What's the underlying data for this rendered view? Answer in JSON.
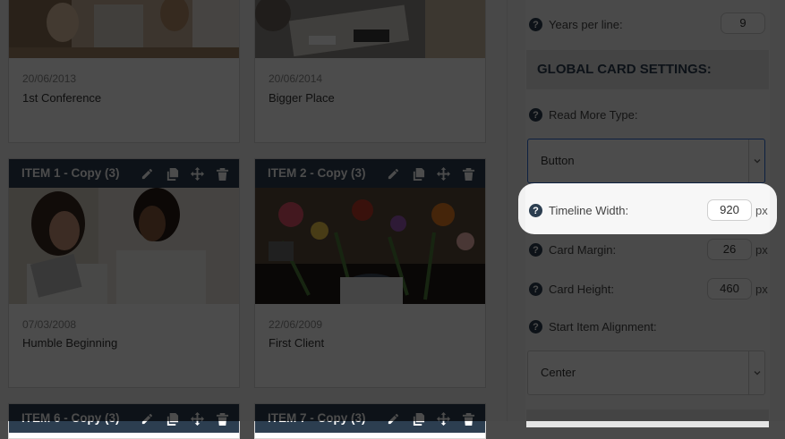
{
  "cards_top": [
    {
      "date": "20/06/2013",
      "title": "1st Conference"
    },
    {
      "date": "20/06/2014",
      "title": "Bigger Place"
    }
  ],
  "cards_mid": [
    {
      "header": "ITEM 1 - Copy (3)",
      "date": "07/03/2008",
      "title": "Humble Beginning"
    },
    {
      "header": "ITEM 2 - Copy (3)",
      "date": "22/06/2009",
      "title": "First Client"
    }
  ],
  "cards_bottom": [
    {
      "header": "ITEM 6 - Copy (3)"
    },
    {
      "header": "ITEM 7 - Copy (3)"
    }
  ],
  "settings": {
    "years_per_line_label": "Years per line:",
    "years_per_line_value": "9",
    "global_heading": "GLOBAL CARD SETTINGS:",
    "read_more_label": "Read More Type:",
    "read_more_value": "Button",
    "timeline_width_label": "Timeline Width:",
    "timeline_width_value": "920",
    "card_margin_label": "Card Margin:",
    "card_margin_value": "26",
    "card_height_label": "Card Height:",
    "card_height_value": "460",
    "start_align_label": "Start Item Alignment:",
    "start_align_value": "Center",
    "unit": "px",
    "help_glyph": "?"
  },
  "icons": [
    "pencil-icon",
    "copy-icon",
    "move-icon",
    "trash-icon",
    "help-icon",
    "chevron-down-icon"
  ],
  "colors": {
    "header_bg": "#2c3e50",
    "accent": "#2c3e50",
    "overlay": "rgba(0,0,0,0.7)"
  }
}
